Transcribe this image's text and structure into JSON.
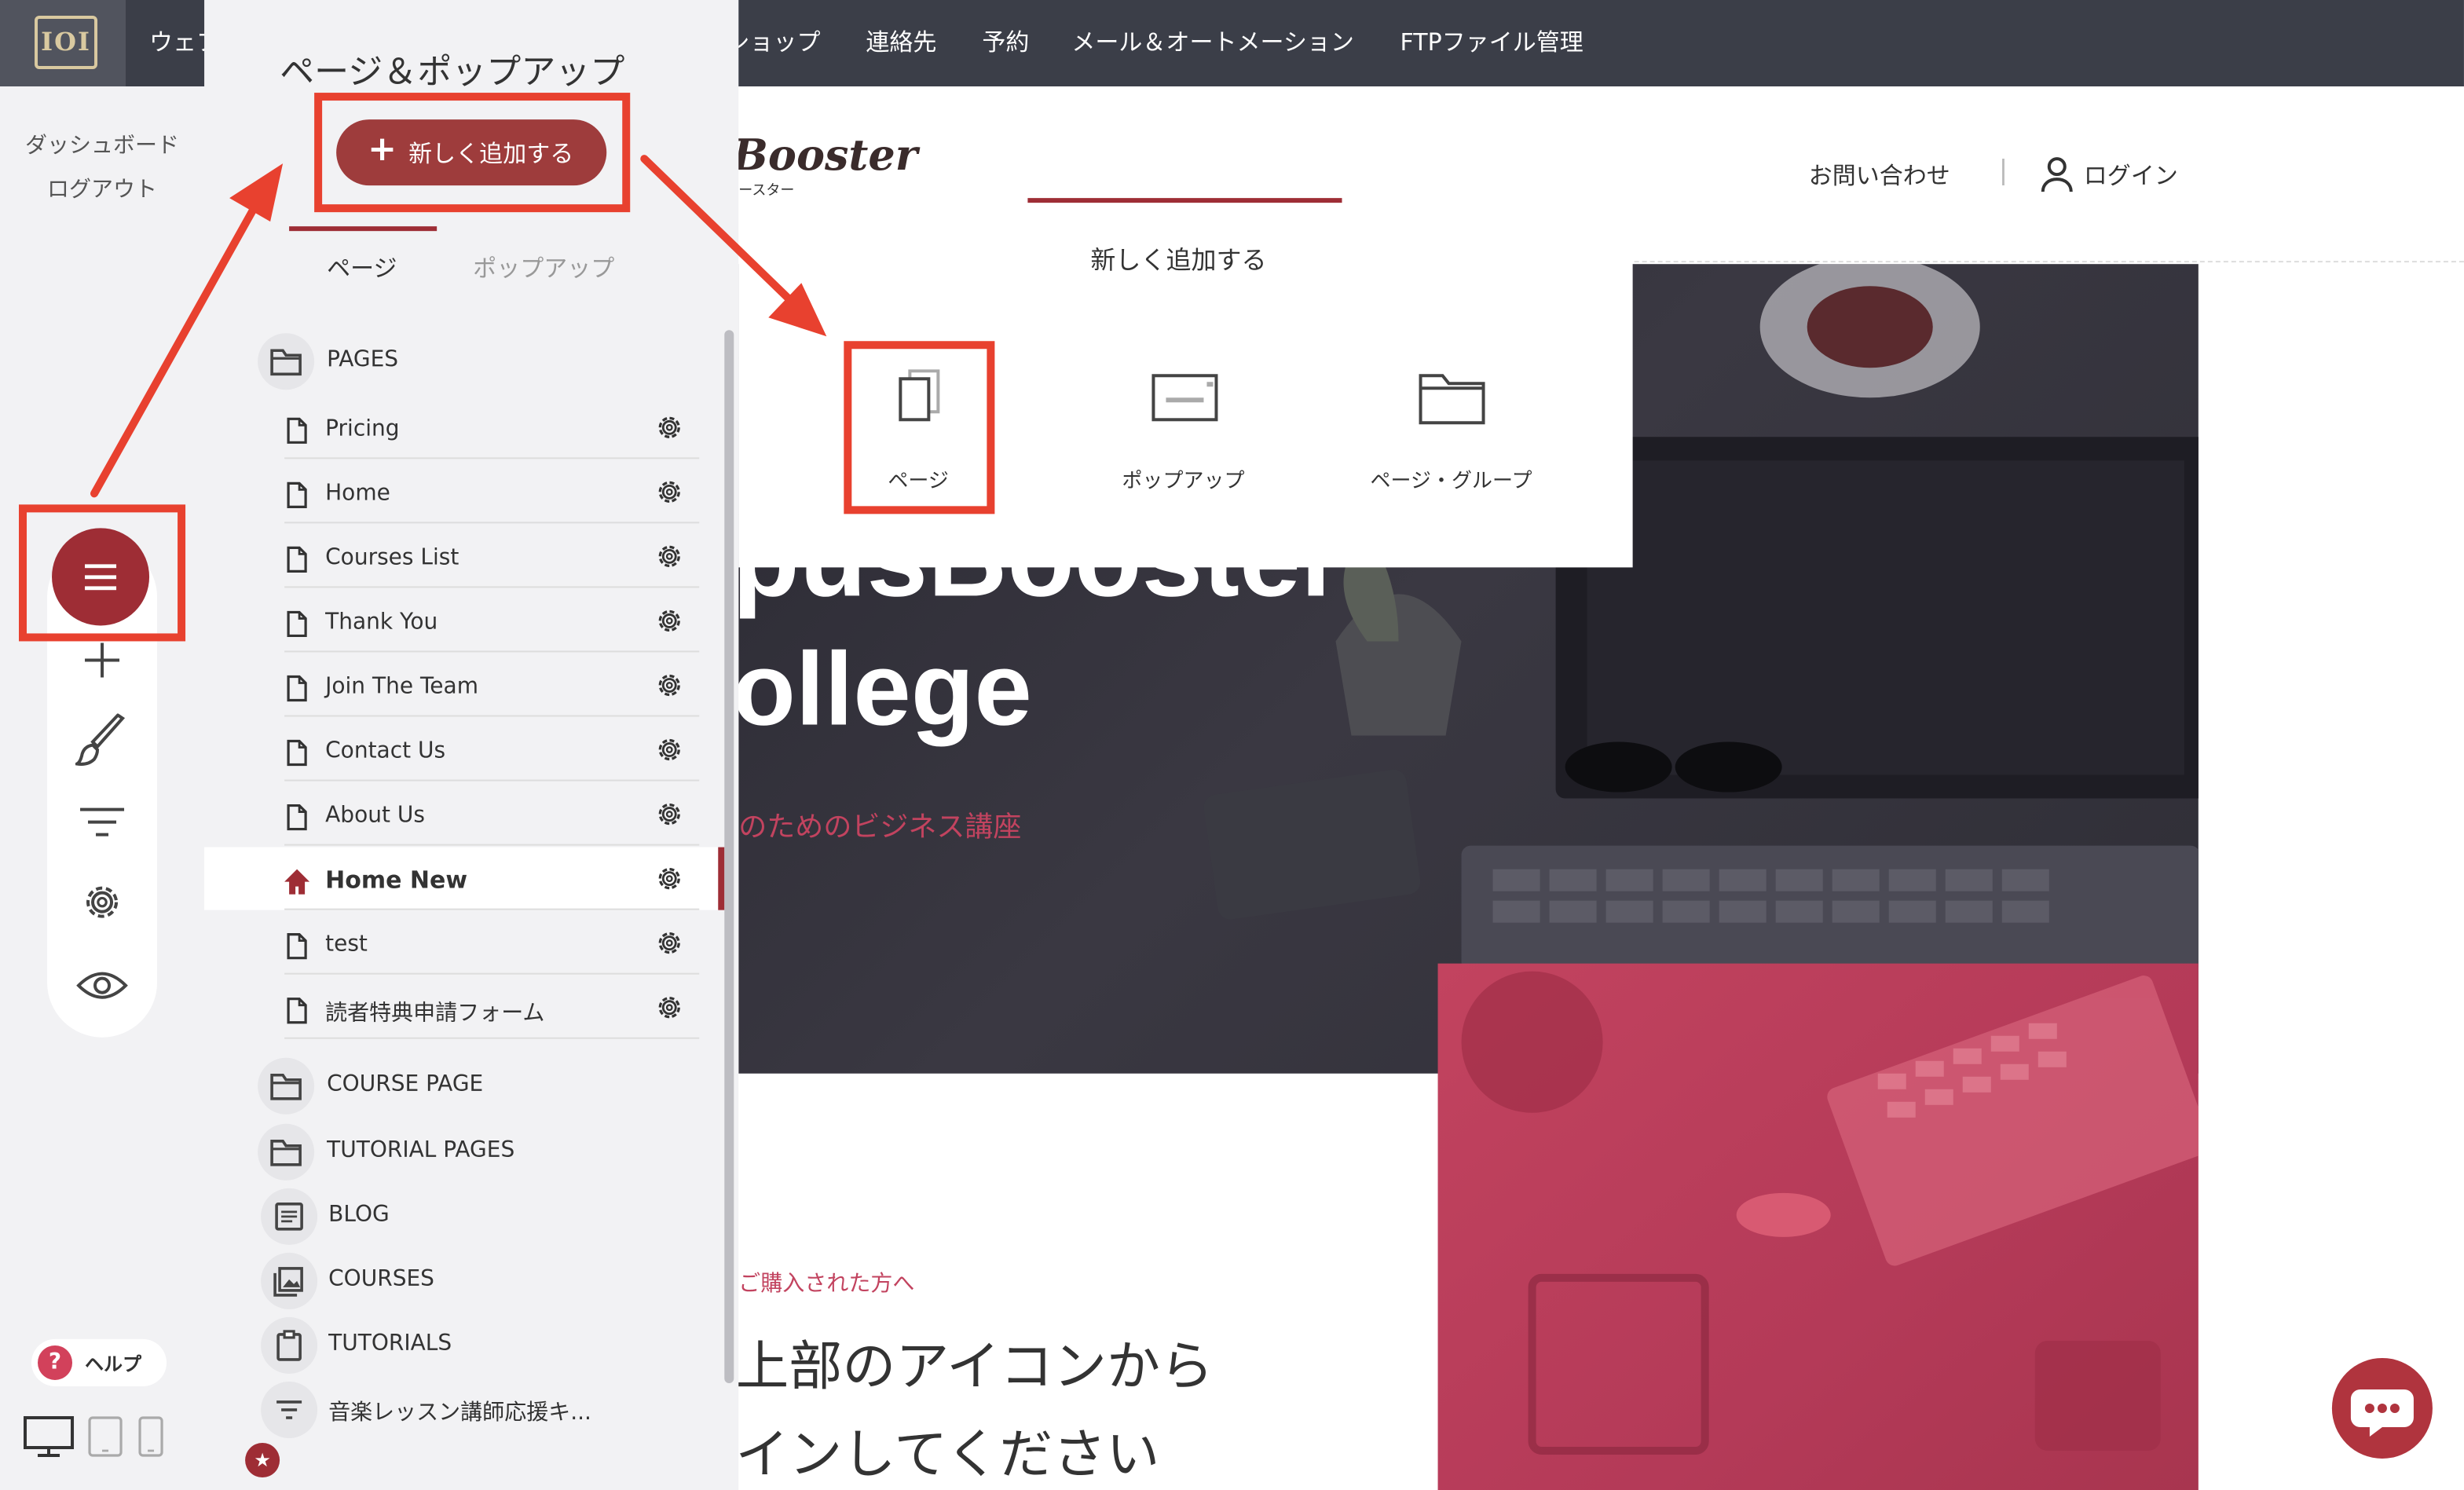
{
  "topbar": {
    "logo_text": "IOI",
    "nav": [
      "ウェブ",
      "ショップ",
      "連絡先",
      "予約",
      "メール＆オートメーション",
      "FTPファイル管理"
    ]
  },
  "rail": {
    "dashboard": "ダッシュボード",
    "logout": "ログアウト",
    "help": "ヘルプ",
    "tools": [
      "menu-icon",
      "plus-icon",
      "brush-icon",
      "filter-icon",
      "gear-icon",
      "eye-icon"
    ]
  },
  "panel": {
    "title": "ページ＆ポップアップ",
    "add_button": "新しく追加する",
    "tabs": [
      "ページ",
      "ポップアップ"
    ],
    "pages_folder": "PAGES",
    "pages": [
      "Pricing",
      "Home",
      "Courses List",
      "Thank You",
      "Join The Team",
      "Contact Us",
      "About Us",
      "Home New",
      "test",
      "読者特典申請フォーム"
    ],
    "active_page": "Home New",
    "groups": [
      "COURSE PAGE",
      "TUTORIAL PAGES",
      "BLOG",
      "COURSES",
      "TUTORIALS",
      "音楽レッスン講師応援キ..."
    ]
  },
  "popup": {
    "title": "新しく追加する",
    "options": [
      "ページ",
      "ポップアップ",
      "ページ・グループ"
    ]
  },
  "site": {
    "logo": "Booster",
    "logo_sub": "ースター",
    "contact": "お問い合わせ",
    "divider": "|",
    "login": "ログイン",
    "hero_line1": "pusBooster",
    "hero_line2": "ollege",
    "hero_sub": "のためのビジネス講座",
    "buyer_label": "ご購入された方へ",
    "body_line1": "上部のアイコンから",
    "body_line2": "インしてください"
  },
  "colors": {
    "accent": "#9e2d35",
    "annotation": "#e8412f",
    "topbar": "#3b3e48",
    "hero_pink": "#c2435f"
  }
}
